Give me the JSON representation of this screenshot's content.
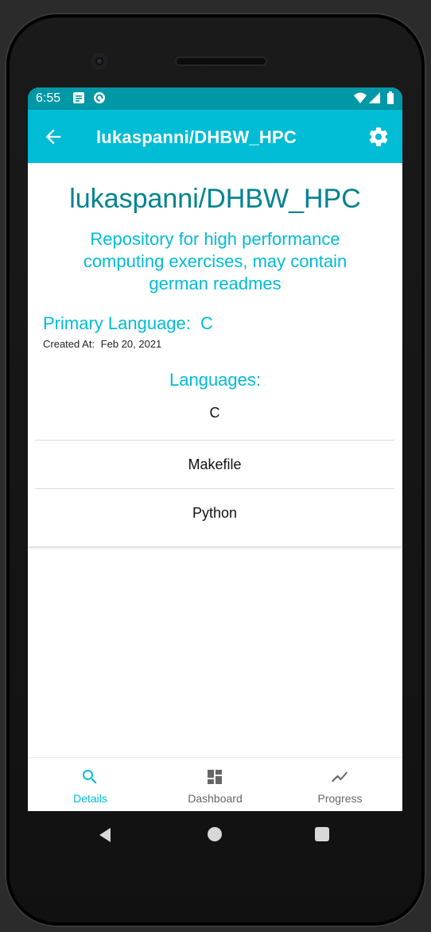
{
  "status": {
    "time": "6:55"
  },
  "appbar": {
    "title": "lukaspanni/DHBW_HPC"
  },
  "repo": {
    "title": "lukaspanni/DHBW_HPC",
    "description": "Repository for high performance computing exercises, may contain german readmes",
    "primary_language_label": "Primary Language:",
    "primary_language": "C",
    "created_label": "Created At:",
    "created_value": "Feb 20, 2021"
  },
  "languages": {
    "heading": "Languages:",
    "items": [
      "C",
      "Makefile",
      "Python"
    ]
  },
  "bottom_nav": {
    "items": [
      {
        "label": "Details",
        "icon": "search-icon",
        "active": true
      },
      {
        "label": "Dashboard",
        "icon": "dashboard-icon",
        "active": false
      },
      {
        "label": "Progress",
        "icon": "trending-up-icon",
        "active": false
      }
    ]
  },
  "colors": {
    "primary": "#00bcd4",
    "primary_dark": "#0097a7",
    "title_teal": "#00838f"
  }
}
